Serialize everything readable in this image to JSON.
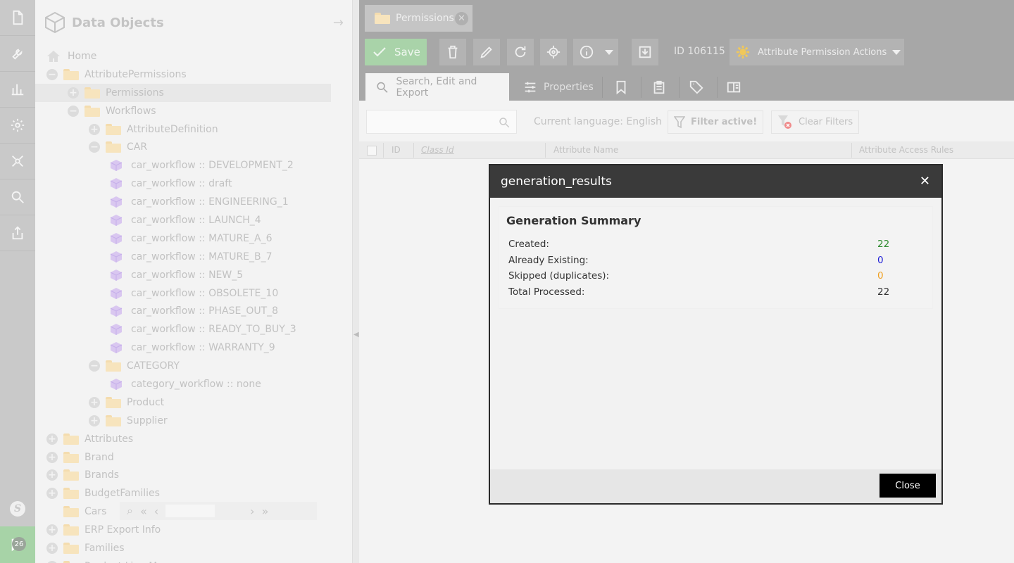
{
  "leftbar": {
    "icons": [
      "file-icon",
      "wrench-icon",
      "chart-icon",
      "gear-icon",
      "network-icon",
      "search-icon",
      "export-icon"
    ],
    "bottom_logo": "S",
    "notification_count": "26"
  },
  "tree": {
    "title": "Data Objects",
    "rows": [
      {
        "label": "Home",
        "indent": 0,
        "toggle": "none",
        "icon": "home"
      },
      {
        "label": "AttributePermissions",
        "indent": 0,
        "toggle": "minus",
        "icon": "folder"
      },
      {
        "label": "Permissions",
        "indent": 1,
        "toggle": "plus",
        "icon": "folder",
        "selected": true
      },
      {
        "label": "Workflows",
        "indent": 1,
        "toggle": "minus",
        "icon": "folder"
      },
      {
        "label": "AttributeDefinition",
        "indent": 2,
        "toggle": "plus",
        "icon": "folder"
      },
      {
        "label": "CAR",
        "indent": 2,
        "toggle": "minus",
        "icon": "folder"
      },
      {
        "label": "car_workflow :: DEVELOPMENT_2",
        "indent": 3,
        "toggle": "none",
        "icon": "object"
      },
      {
        "label": "car_workflow :: draft",
        "indent": 3,
        "toggle": "none",
        "icon": "object"
      },
      {
        "label": "car_workflow :: ENGINEERING_1",
        "indent": 3,
        "toggle": "none",
        "icon": "object"
      },
      {
        "label": "car_workflow :: LAUNCH_4",
        "indent": 3,
        "toggle": "none",
        "icon": "object"
      },
      {
        "label": "car_workflow :: MATURE_A_6",
        "indent": 3,
        "toggle": "none",
        "icon": "object"
      },
      {
        "label": "car_workflow :: MATURE_B_7",
        "indent": 3,
        "toggle": "none",
        "icon": "object"
      },
      {
        "label": "car_workflow :: NEW_5",
        "indent": 3,
        "toggle": "none",
        "icon": "object"
      },
      {
        "label": "car_workflow :: OBSOLETE_10",
        "indent": 3,
        "toggle": "none",
        "icon": "object"
      },
      {
        "label": "car_workflow :: PHASE_OUT_8",
        "indent": 3,
        "toggle": "none",
        "icon": "object"
      },
      {
        "label": "car_workflow :: READY_TO_BUY_3",
        "indent": 3,
        "toggle": "none",
        "icon": "object"
      },
      {
        "label": "car_workflow :: WARRANTY_9",
        "indent": 3,
        "toggle": "none",
        "icon": "object"
      },
      {
        "label": "CATEGORY",
        "indent": 2,
        "toggle": "minus",
        "icon": "folder"
      },
      {
        "label": "category_workflow :: none",
        "indent": 3,
        "toggle": "none",
        "icon": "object"
      },
      {
        "label": "Product",
        "indent": 2,
        "toggle": "plus",
        "icon": "folder"
      },
      {
        "label": "Supplier",
        "indent": 2,
        "toggle": "plus",
        "icon": "folder"
      },
      {
        "label": "Attributes",
        "indent": 0,
        "toggle": "plus",
        "icon": "folder"
      },
      {
        "label": "Brand",
        "indent": 0,
        "toggle": "plus",
        "icon": "folder"
      },
      {
        "label": "Brands",
        "indent": 0,
        "toggle": "plus",
        "icon": "folder"
      },
      {
        "label": "BudgetFamilies",
        "indent": 0,
        "toggle": "plus",
        "icon": "folder"
      },
      {
        "label": "Cars",
        "indent": 0,
        "toggle": "spacer",
        "icon": "folder"
      },
      {
        "label": "ERP Export Info",
        "indent": 0,
        "toggle": "plus",
        "icon": "folder"
      },
      {
        "label": "Families",
        "indent": 0,
        "toggle": "plus",
        "icon": "folder"
      },
      {
        "label": "Product Line M...",
        "indent": 0,
        "toggle": "plus",
        "icon": "folder"
      }
    ]
  },
  "tab": {
    "label": "Permissions"
  },
  "toolbar": {
    "save_label": "Save",
    "id_label": "ID 106115",
    "actions_label": "Attribute Permission Actions"
  },
  "subtabs": {
    "search_label": "Search, Edit and Export",
    "properties_label": "Properties"
  },
  "filterbar": {
    "search_placeholder": "",
    "language_label": "Current language: English",
    "filter_active_label": "Filter active!",
    "clear_filters_label": "Clear Filters"
  },
  "grid": {
    "columns": [
      "ID",
      "Class Id",
      "Attribute Name",
      "Attribute Access Rules"
    ]
  },
  "modal": {
    "title": "generation_results",
    "summary_title": "Generation Summary",
    "rows": [
      {
        "label": "Created:",
        "value": "22",
        "color": "#2e8b2e"
      },
      {
        "label": "Already Existing:",
        "value": "0",
        "color": "#1f1fd6"
      },
      {
        "label": "Skipped (duplicates):",
        "value": "0",
        "color": "#f0a020"
      },
      {
        "label": "Total Processed:",
        "value": "22",
        "color": "#333333"
      }
    ],
    "close_label": "Close"
  }
}
